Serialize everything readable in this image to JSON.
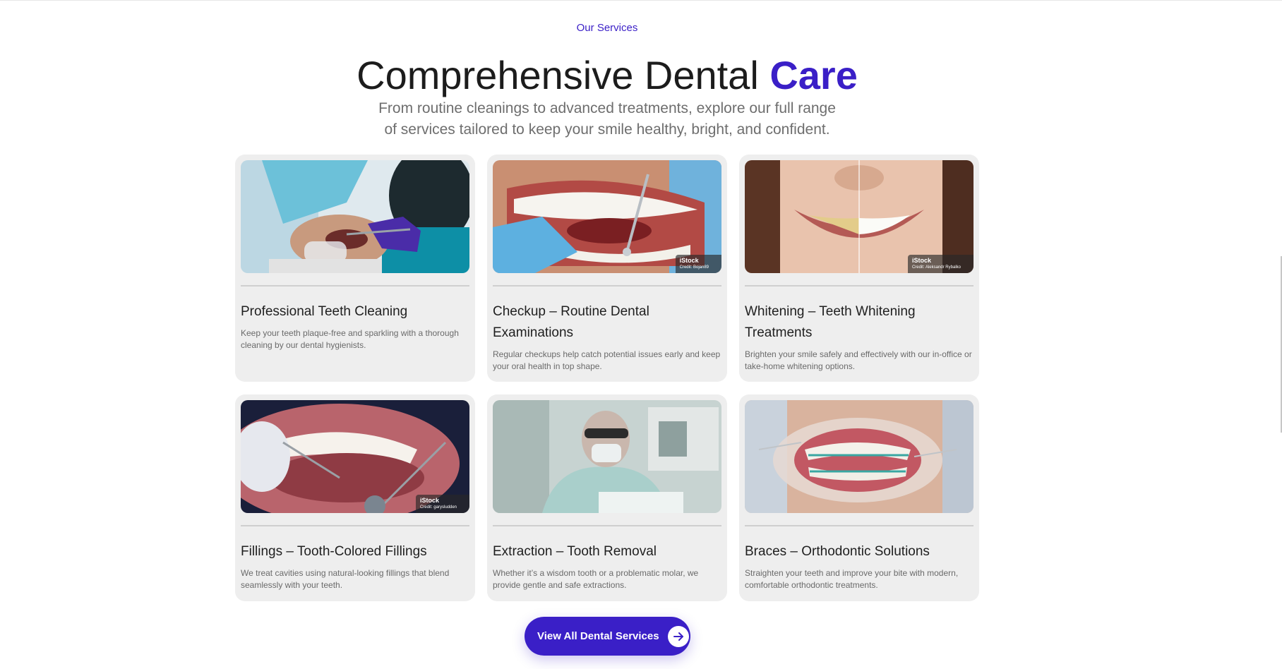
{
  "section": {
    "eyebrow": "Our Services",
    "headline_main": "Comprehensive Dental ",
    "headline_accent": "Care",
    "intro_line1": "From routine cleanings to advanced treatments, explore our full range",
    "intro_line2": "of services tailored to keep your smile healthy, bright, and confident."
  },
  "services": [
    {
      "title": "Professional Teeth Cleaning",
      "description": "Keep your teeth plaque-free and sparkling with a thorough cleaning by our dental hygienists."
    },
    {
      "title": "Checkup – Routine Dental Examinations",
      "description": "Regular checkups help catch potential issues early and keep your oral health in top shape.",
      "stock_brand": "iStock",
      "stock_credit": "Credit: Bojan89"
    },
    {
      "title": "Whitening – Teeth Whitening Treatments",
      "description": "Brighten your smile safely and effectively with our in-office or take-home whitening options.",
      "stock_brand": "iStock",
      "stock_credit": "Credit: Aleksandr Rybalko"
    },
    {
      "title": "Fillings – Tooth-Colored Fillings",
      "description": "We treat cavities using natural-looking fillings that blend seamlessly with your teeth.",
      "stock_brand": "iStock",
      "stock_credit": "Credit: garysludden"
    },
    {
      "title": "Extraction – Tooth Removal",
      "description": "Whether it’s a wisdom tooth or a problematic molar, we provide gentle and safe extractions."
    },
    {
      "title": "Braces – Orthodontic Solutions",
      "description": "Straighten your teeth and improve your bite with modern, comfortable orthodontic treatments."
    }
  ],
  "cta": {
    "label": "View All Dental Services",
    "icon": "arrow-right-icon"
  },
  "colors": {
    "accent": "#3a1fc7",
    "card_bg": "#eeeeee",
    "heading": "#1c1c1c",
    "body_text": "#6a6a6a"
  }
}
